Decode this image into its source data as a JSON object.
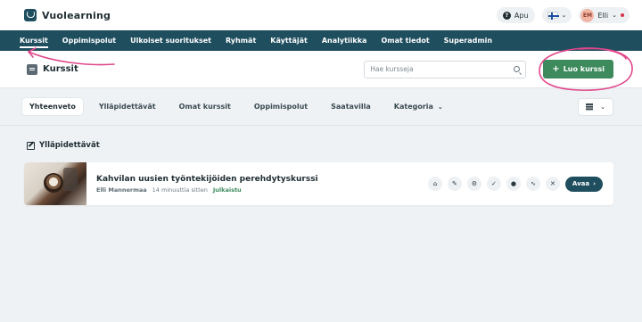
{
  "app": {
    "brand": "Vuolearning"
  },
  "topbar": {
    "help_label": "Apu",
    "user_initials": "EM",
    "user_name": "Elli"
  },
  "nav": {
    "items": [
      {
        "label": "Kurssit",
        "active": true
      },
      {
        "label": "Oppimispolut"
      },
      {
        "label": "Ulkoiset suoritukset"
      },
      {
        "label": "Ryhmät"
      },
      {
        "label": "Käyttäjät"
      },
      {
        "label": "Analytiikka"
      },
      {
        "label": "Omat tiedot"
      },
      {
        "label": "Superadmin"
      }
    ]
  },
  "header": {
    "title": "Kurssit",
    "search_placeholder": "Hae kursseja",
    "create_label": "Luo kurssi"
  },
  "tabs": {
    "items": [
      {
        "label": "Yhteenveto",
        "active": true
      },
      {
        "label": "Ylläpidettävät"
      },
      {
        "label": "Omat kurssit"
      },
      {
        "label": "Oppimispolut"
      },
      {
        "label": "Saatavilla"
      },
      {
        "label": "Kategoria"
      }
    ]
  },
  "section": {
    "title": "Ylläpidettävät"
  },
  "course": {
    "title": "Kahvilan uusien työntekijöiden perehdytyskurssi",
    "author": "Elli Mannermaa",
    "updated": "14 minuuttia sitten",
    "status": "Julkaistu",
    "open_label": "Avaa"
  },
  "colors": {
    "nav_bg": "#1f4e5f",
    "primary_green": "#3d8a5c",
    "annotation_pink": "#e0478a"
  }
}
